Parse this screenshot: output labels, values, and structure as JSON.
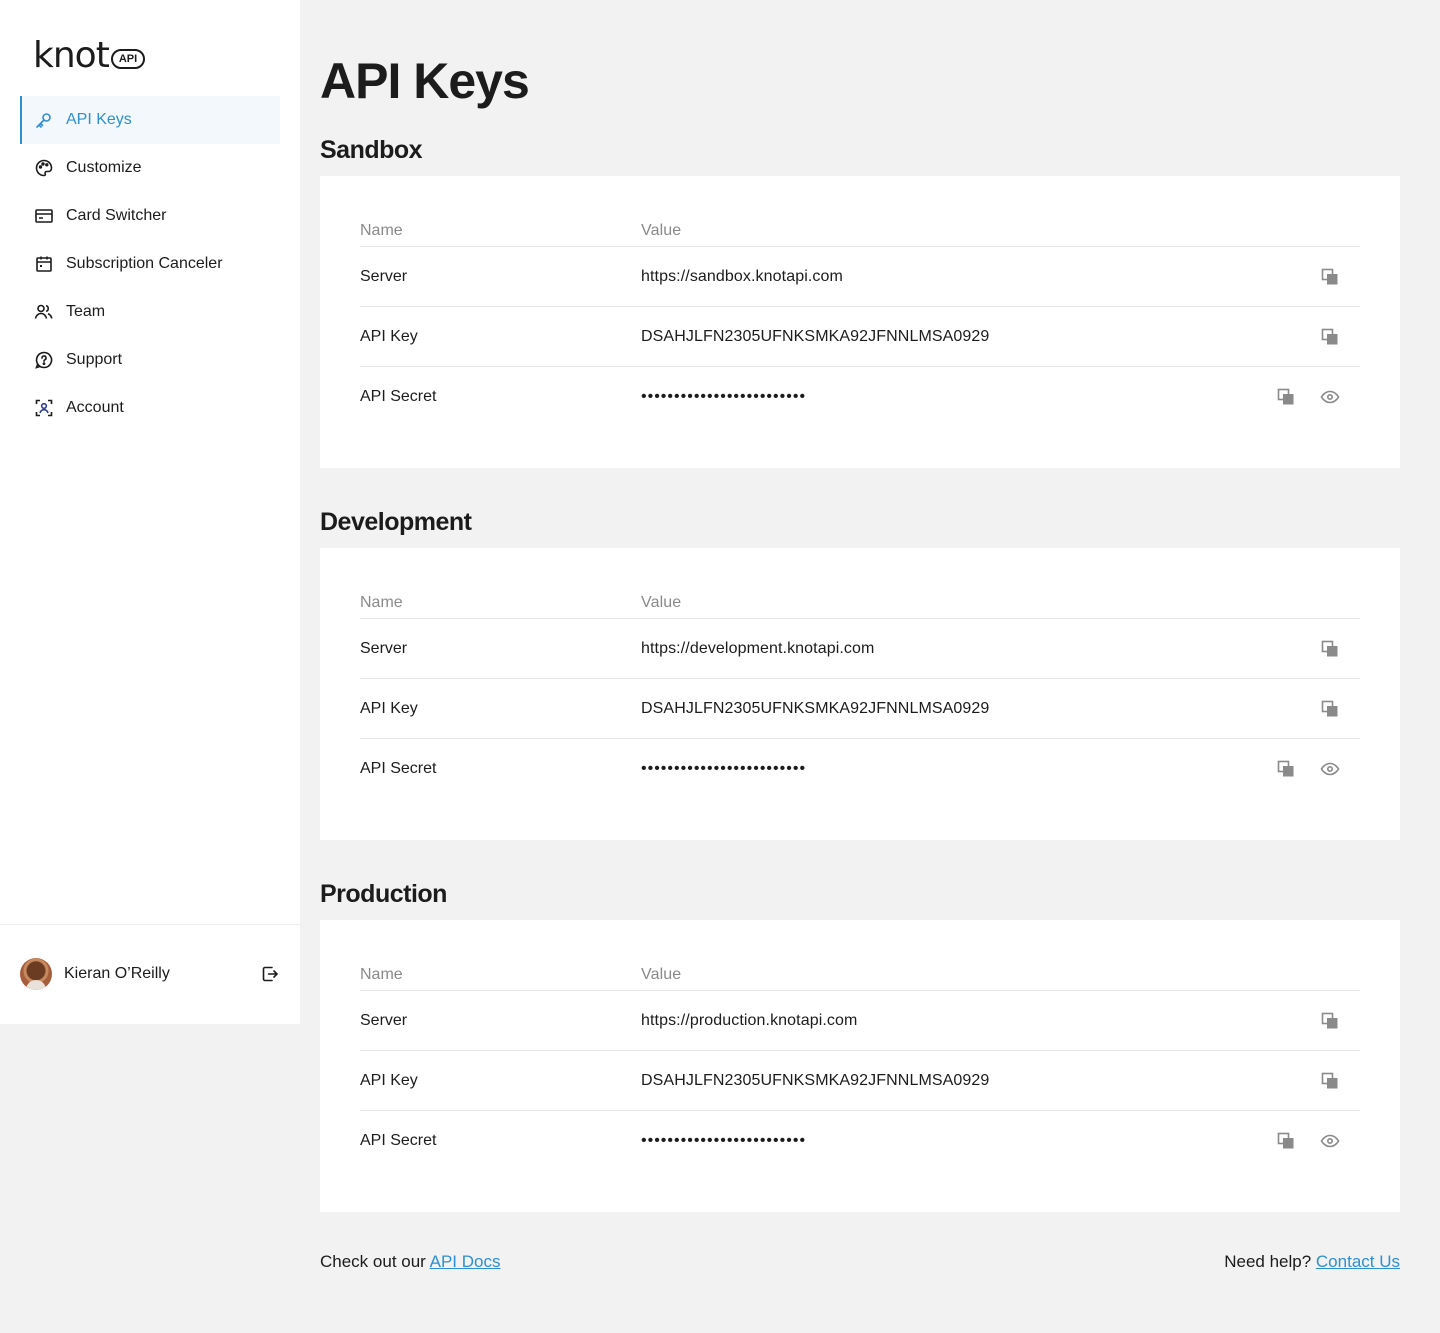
{
  "brand": {
    "word": "knot",
    "pill": "API"
  },
  "nav": [
    {
      "label": "API Keys",
      "icon": "key-icon",
      "active": true
    },
    {
      "label": "Customize",
      "icon": "palette-icon"
    },
    {
      "label": "Card Switcher",
      "icon": "credit-card-icon"
    },
    {
      "label": "Subscription Canceler",
      "icon": "calendar-icon"
    },
    {
      "label": "Team",
      "icon": "users-icon"
    },
    {
      "label": "Support",
      "icon": "help-circle-icon"
    },
    {
      "label": "Account",
      "icon": "account-scan-icon"
    }
  ],
  "user": {
    "name": "Kieran O’Reilly"
  },
  "page": {
    "title": "API Keys"
  },
  "table_headers": {
    "name": "Name",
    "value": "Value"
  },
  "sections": [
    {
      "title": "Sandbox",
      "rows": [
        {
          "name": "Server",
          "value": "https://sandbox.knotapi.com"
        },
        {
          "name": "API Key",
          "value": "DSAHJLFN2305UFNKSMKA92JFNNLMSA0929"
        },
        {
          "name": "API Secret",
          "value": "•••••••••••••••••••••••••"
        }
      ]
    },
    {
      "title": "Development",
      "rows": [
        {
          "name": "Server",
          "value": "https://development.knotapi.com"
        },
        {
          "name": "API Key",
          "value": "DSAHJLFN2305UFNKSMKA92JFNNLMSA0929"
        },
        {
          "name": "API Secret",
          "value": "•••••••••••••••••••••••••"
        }
      ]
    },
    {
      "title": "Production",
      "rows": [
        {
          "name": "Server",
          "value": "https://production.knotapi.com"
        },
        {
          "name": "API Key",
          "value": "DSAHJLFN2305UFNKSMKA92JFNNLMSA0929"
        },
        {
          "name": "API Secret",
          "value": "•••••••••••••••••••••••••"
        }
      ]
    }
  ],
  "footer": {
    "left_text": "Check out our ",
    "left_link": "API Docs",
    "right_text": "Need help? ",
    "right_link": "Contact Us"
  },
  "colors": {
    "accent": "#2f8fd3",
    "background": "#f2f2f2",
    "card": "#ffffff"
  }
}
